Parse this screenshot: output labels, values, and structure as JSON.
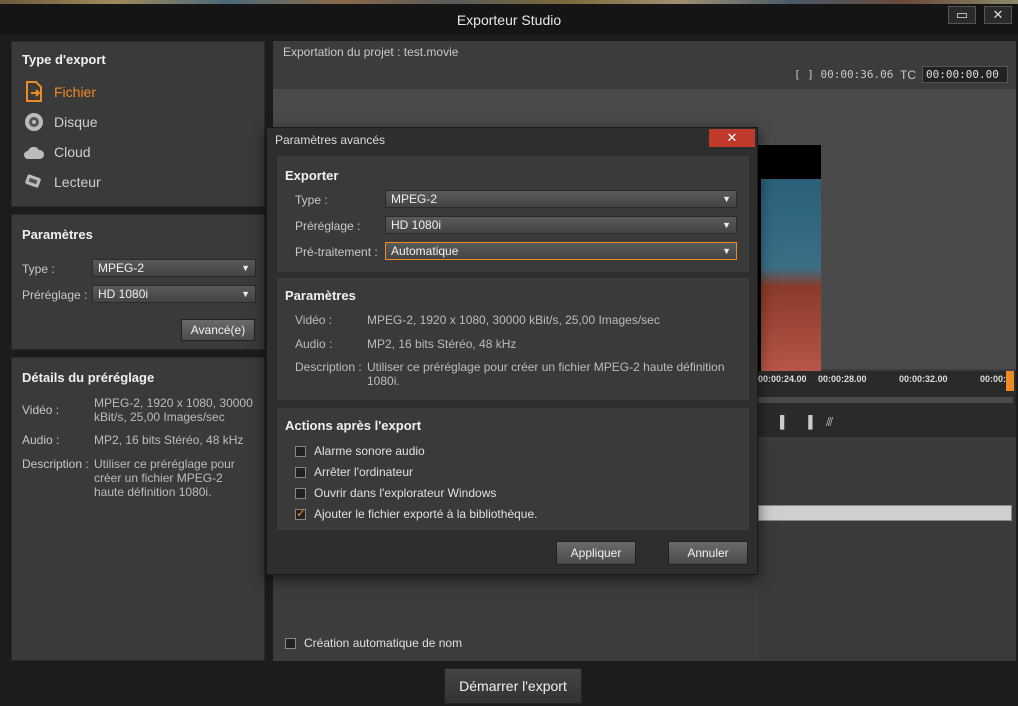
{
  "window": {
    "title": "Exporteur Studio",
    "restore": "▭",
    "close": "✕"
  },
  "export_type": {
    "heading": "Type d'export",
    "items": [
      {
        "label": "Fichier",
        "icon": "file-export-icon",
        "active": true
      },
      {
        "label": "Disque",
        "icon": "disc-icon"
      },
      {
        "label": "Cloud",
        "icon": "cloud-icon"
      },
      {
        "label": "Lecteur",
        "icon": "device-icon"
      }
    ]
  },
  "params": {
    "heading": "Paramètres",
    "type_label": "Type :",
    "type_value": "MPEG-2",
    "preset_label": "Préréglage :",
    "preset_value": "HD 1080i",
    "advanced_button": "Avancé(e)"
  },
  "preset_details": {
    "heading": "Détails du préréglage",
    "video_label": "Vidéo :",
    "video_value": "MPEG-2, 1920 x 1080, 30000 kBit/s, 25,00 Images/sec",
    "audio_label": "Audio :",
    "audio_value": "MP2, 16 bits Stéréo, 48 kHz",
    "desc_label": "Description :",
    "desc_value": "Utiliser ce préréglage pour créer un fichier MPEG-2 haute définition 1080i."
  },
  "main": {
    "project": "Exportation du projet : test.movie",
    "duration": "[ ] 00:00:36.06",
    "tc_label": "TC",
    "tc_value": "00:00:00.00",
    "ticks": [
      "00:00:24.00",
      "00:00:28.00",
      "00:00:32.00",
      "00:00:"
    ],
    "auto_name": "Création automatique de nom",
    "start_export": "Démarrer l'export"
  },
  "dialog": {
    "title": "Paramètres avancés",
    "close": "✕",
    "exporter": {
      "heading": "Exporter",
      "type_label": "Type :",
      "type_value": "MPEG-2",
      "preset_label": "Préréglage :",
      "preset_value": "HD 1080i",
      "pre_label": "Pré-traitement :",
      "pre_value": "Automatique"
    },
    "parameters": {
      "heading": "Paramètres",
      "video_label": "Vidéo :",
      "video_value": "MPEG-2, 1920 x 1080, 30000 kBit/s, 25,00 Images/sec",
      "audio_label": "Audio :",
      "audio_value": "MP2, 16 bits Stéréo, 48 kHz",
      "desc_label": "Description :",
      "desc_value": "Utiliser ce préréglage pour créer un fichier MPEG-2 haute définition 1080i."
    },
    "actions": {
      "heading": "Actions après l'export",
      "items": [
        {
          "label": "Alarme sonore audio",
          "checked": false
        },
        {
          "label": "Arrêter l'ordinateur",
          "checked": false
        },
        {
          "label": "Ouvrir dans l'explorateur Windows",
          "checked": false
        },
        {
          "label": "Ajouter le fichier exporté à la bibliothèque.",
          "checked": true
        }
      ]
    },
    "apply": "Appliquer",
    "cancel": "Annuler"
  },
  "colors": {
    "accent": "#f08a24",
    "close_red": "#c0392b"
  }
}
